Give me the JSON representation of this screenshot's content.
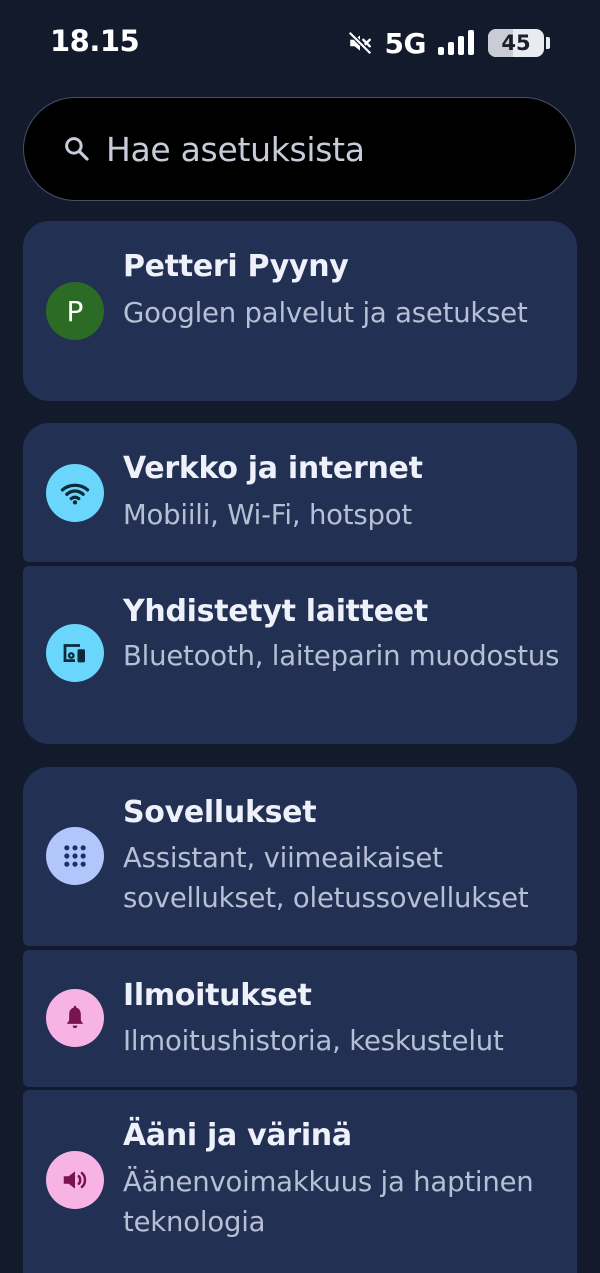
{
  "status_bar": {
    "time": "18.15",
    "network": "5G",
    "battery_percent": "45",
    "battery_level": 0.45,
    "icons": [
      "mute-icon",
      "signal-icon",
      "battery-icon"
    ]
  },
  "search": {
    "placeholder": "Hae asetuksista",
    "icon": "search-icon"
  },
  "account": {
    "avatar_letter": "P",
    "name": "Petteri Pyyny",
    "subtitle": "Googlen palvelut ja asetukset",
    "avatar_color": "#2c6b25"
  },
  "items": [
    {
      "title": "Verkko ja internet",
      "subtitle": "Mobiili, Wi-Fi, hotspot",
      "icon": "wifi-icon",
      "icon_color": "#6ad6fb"
    },
    {
      "title": "Yhdistetyt laitteet",
      "subtitle": "Bluetooth, laiteparin muodostus",
      "icon": "connected-devices-icon",
      "icon_color": "#6ad6fb"
    },
    {
      "title": "Sovellukset",
      "subtitle": "Assistant, viimeaikaiset sovellukset, oletussovellukset",
      "icon": "apps-grid-icon",
      "icon_color": "#b2c6fb"
    },
    {
      "title": "Ilmoitukset",
      "subtitle": "Ilmoitushistoria, keskustelut",
      "icon": "bell-icon",
      "icon_color": "#f6b3e4"
    },
    {
      "title": "Ääni ja värinä",
      "subtitle": "Äänenvoimakkuus ja haptinen teknologia",
      "icon": "speaker-icon",
      "icon_color": "#f6b3e4"
    }
  ],
  "colors": {
    "background": "#121a2c",
    "card": "#223053",
    "search_background": "#000000"
  }
}
